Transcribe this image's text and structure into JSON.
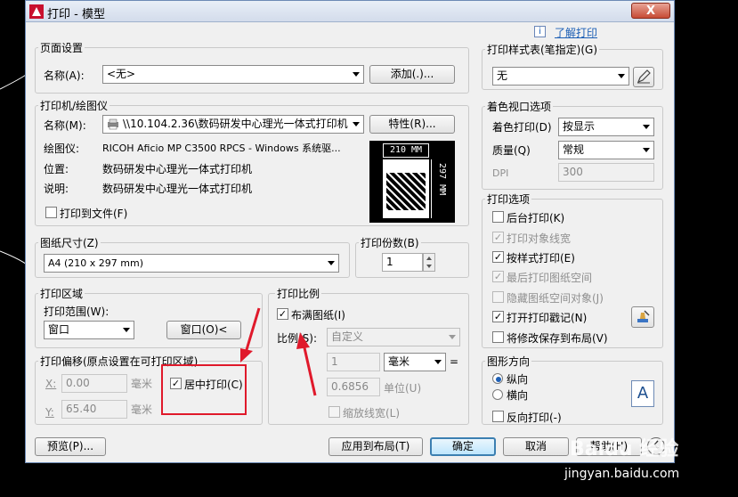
{
  "window": {
    "title": "打印 - 模型",
    "close_label": "X"
  },
  "help": {
    "info_label": "i",
    "link": "了解打印"
  },
  "page_setup": {
    "title": "页面设置",
    "name_label": "名称(A):",
    "name_value": "<无>",
    "add_button": "添加(.)..."
  },
  "printer": {
    "title": "打印机/绘图仪",
    "name_label": "名称(M):",
    "name_value": "\\\\10.104.2.36\\数码研发中心理光一体式打印机",
    "properties_button": "特性(R)...",
    "plotter_label": "绘图仪:",
    "plotter_value": "RICOH Aficio MP C3500 RPCS - Windows 系统驱...",
    "location_label": "位置:",
    "location_value": "数码研发中心理光一体式打印机",
    "description_label": "说明:",
    "description_value": "数码研发中心理光一体式打印机",
    "print_to_file": "打印到文件(F)",
    "preview_width": "210 MM",
    "preview_height": "297 MM"
  },
  "paper_size": {
    "title": "图纸尺寸(Z)",
    "value": "A4 (210 x 297 mm)"
  },
  "copies": {
    "title": "打印份数(B)",
    "value": "1"
  },
  "print_area": {
    "title": "打印区域",
    "range_label": "打印范围(W):",
    "range_value": "窗口",
    "window_button": "窗口(O)<"
  },
  "print_offset": {
    "title": "打印偏移(原点设置在可打印区域)",
    "x_label": "X:",
    "x_value": "0.00",
    "x_unit": "毫米",
    "y_label": "Y:",
    "y_value": "65.40",
    "y_unit": "毫米",
    "center_label": "居中打印(C)"
  },
  "print_scale": {
    "title": "打印比例",
    "fit_label": "布满图纸(I)",
    "scale_label": "比例(S):",
    "scale_value": "自定义",
    "value1": "1",
    "unit1": "毫米",
    "equals": "=",
    "value2": "0.6856",
    "unit2": "单位(U)",
    "lineweights_label": "缩放线宽(L)"
  },
  "plot_style": {
    "title": "打印样式表(笔指定)(G)",
    "value": "无"
  },
  "shaded_viewport": {
    "title": "着色视口选项",
    "shade_label": "着色打印(D)",
    "shade_value": "按显示",
    "quality_label": "质量(Q)",
    "quality_value": "常规",
    "dpi_label": "DPI",
    "dpi_value": "300"
  },
  "plot_options": {
    "title": "打印选项",
    "items": [
      {
        "label": "后台打印(K)",
        "checked": "",
        "disabled": false
      },
      {
        "label": "打印对象线宽",
        "checked": "✓",
        "disabled": true
      },
      {
        "label": "按样式打印(E)",
        "checked": "✓",
        "disabled": false
      },
      {
        "label": "最后打印图纸空间",
        "checked": "✓",
        "disabled": true
      },
      {
        "label": "隐藏图纸空间对象(J)",
        "checked": "",
        "disabled": true
      },
      {
        "label": "打开打印戳记(N)",
        "checked": "✓",
        "disabled": false
      },
      {
        "label": "将修改保存到布局(V)",
        "checked": "",
        "disabled": false
      }
    ]
  },
  "orientation": {
    "title": "图形方向",
    "portrait": "纵向",
    "landscape": "横向",
    "reverse": "反向打印(-)",
    "icon_letter": "A"
  },
  "footer": {
    "preview": "预览(P)...",
    "apply": "应用到布局(T)",
    "ok": "确定",
    "cancel": "取消",
    "help": "帮助(H)"
  },
  "watermark": {
    "brand": "Baidu 经验",
    "url": "jingyan.baidu.com"
  },
  "colors": {
    "annotation_red": "#e0192b",
    "accent_blue": "#1d5fb5"
  }
}
